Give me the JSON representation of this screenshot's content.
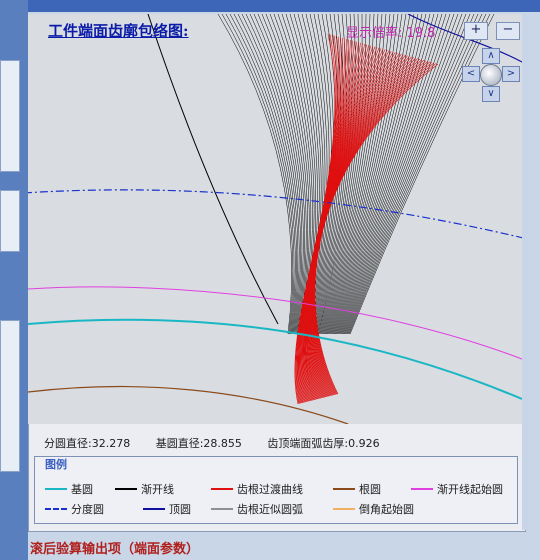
{
  "plot": {
    "title": "工件端面齿廓包络图:",
    "zoom_label": "显示倍率: 19.8",
    "zoom_in": "+",
    "zoom_out": "−"
  },
  "nav": {
    "up": "∧",
    "down": "∨",
    "left": "<",
    "right": ">"
  },
  "info": {
    "pitch_diameter": "分圆直径:32.278",
    "base_diameter": "基圆直径:28.855",
    "tip_thickness": "齿顶端面弧齿厚:0.926"
  },
  "legend": {
    "title": "图例",
    "items": [
      {
        "label": "基圆",
        "color": "#19b7c4",
        "style": "solid"
      },
      {
        "label": "渐开线",
        "color": "#000000",
        "style": "solid"
      },
      {
        "label": "齿根过渡曲线",
        "color": "#e01010",
        "style": "solid"
      },
      {
        "label": "根圆",
        "color": "#8b4a1a",
        "style": "solid"
      },
      {
        "label": "渐开线起始圆",
        "color": "#e040e0",
        "style": "solid"
      },
      {
        "label": "分度圆",
        "color": "#1830d0",
        "style": "dashdot"
      },
      {
        "label": "顶圆",
        "color": "#1010a0",
        "style": "solid"
      },
      {
        "label": "齿根近似圆弧",
        "color": "#909090",
        "style": "solid"
      },
      {
        "label": "倒角起始圆",
        "color": "#f0b060",
        "style": "solid"
      }
    ]
  },
  "footer": {
    "title": "滚后验算输出项（端面参数）"
  }
}
